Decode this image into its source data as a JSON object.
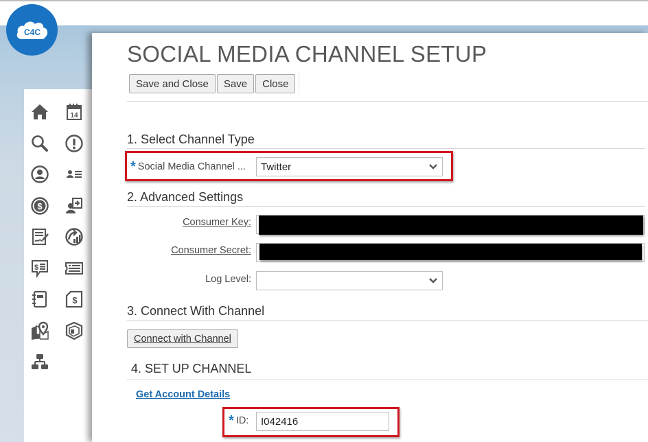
{
  "app": {
    "logo_text": "C4C",
    "brand_color": "#1a73c2"
  },
  "sidebar": {
    "items": [
      {
        "name": "home-icon",
        "label": "Home"
      },
      {
        "name": "calendar-icon",
        "label": "14"
      },
      {
        "name": "search-icon",
        "label": "Search"
      },
      {
        "name": "alert-icon",
        "label": "Alerts"
      },
      {
        "name": "user-icon",
        "label": "Profile"
      },
      {
        "name": "contacts-list-icon",
        "label": "Contacts"
      },
      {
        "name": "dollar-icon",
        "label": "Sales"
      },
      {
        "name": "user-transfer-icon",
        "label": "Leads"
      },
      {
        "name": "signed-document-icon",
        "label": "Contracts"
      },
      {
        "name": "growth-chart-icon",
        "label": "Analytics"
      },
      {
        "name": "quote-chat-icon",
        "label": "Quotes"
      },
      {
        "name": "ticket-list-icon",
        "label": "Tickets"
      },
      {
        "name": "notebook-icon",
        "label": "Notes"
      },
      {
        "name": "invoice-icon",
        "label": "Invoices"
      },
      {
        "name": "map-pin-icon",
        "label": "Territories"
      },
      {
        "name": "product-box-icon",
        "label": "Products"
      },
      {
        "name": "org-chart-icon",
        "label": "Organization"
      }
    ]
  },
  "page": {
    "title": "SOCIAL MEDIA CHANNEL SETUP",
    "toolbar": {
      "save_and_close": "Save and Close",
      "save": "Save",
      "close": "Close"
    }
  },
  "sections": {
    "s1": {
      "title": "1. Select Channel Type",
      "channel_label": "Social Media Channel ...",
      "channel_value": "Twitter",
      "required_mark": "*"
    },
    "s2": {
      "title": "2. Advanced Settings",
      "consumer_key_label": "Consumer Key:",
      "consumer_key_value": "[redacted]",
      "consumer_secret_label": "Consumer Secret:",
      "consumer_secret_value": "[redacted]",
      "log_level_label": "Log Level:",
      "log_level_value": ""
    },
    "s3": {
      "title": "3. Connect With Channel",
      "connect_button": "Connect with Channel"
    },
    "s4": {
      "title": "4. SET UP CHANNEL",
      "get_account_link": "Get Account Details",
      "id_label": "ID:",
      "id_value": "I042416",
      "required_mark": "*"
    }
  },
  "colors": {
    "highlight": "#d0181f",
    "required": "#1f79c0",
    "link": "#1e6bb0",
    "band": "#a9c5dc"
  }
}
